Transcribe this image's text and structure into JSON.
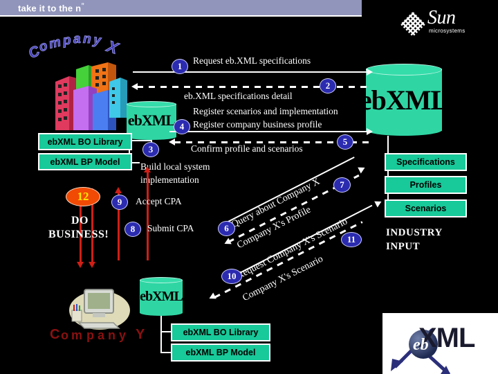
{
  "banner": {
    "text": "take it to the n",
    "superscript": "”"
  },
  "brand": {
    "name": "Sun",
    "tagline": "microsystems",
    "logo_icon": "sun-logo-icon"
  },
  "companies": {
    "left": {
      "name": "Company X",
      "color": "#3b37b5"
    },
    "right": {
      "name": "Company Y",
      "color": "#8a1111"
    }
  },
  "repositories": {
    "left_cylinder": "ebXML",
    "right_cylinder": "ebXML",
    "bottom_cylinder": "ebXML"
  },
  "boxes": {
    "x_bo_library": "ebXML BO Library",
    "x_bp_model": "ebXML BP Model",
    "y_bo_library": "ebXML BO Library",
    "y_bp_model": "ebXML BP Model",
    "registry": [
      "Specifications",
      "Profiles",
      "Scenarios"
    ]
  },
  "flows": [
    {
      "num": "1",
      "label": "Request eb.XML specifications",
      "style": "solid"
    },
    {
      "num": "2",
      "label": "eb.XML specifications detail",
      "style": "dashed"
    },
    {
      "num": "3",
      "label": "Build local system implementation",
      "style": "none"
    },
    {
      "num": "4",
      "label": "Register scenarios and implementation",
      "label2": "Register company business profile",
      "style": "solid"
    },
    {
      "num": "5",
      "label": "Confirm profile and scenarios",
      "style": "dashed"
    },
    {
      "num": "6",
      "label": "Query about Company X",
      "style": "solid"
    },
    {
      "num": "7",
      "label": "Company X's Profile",
      "style": "dashed"
    },
    {
      "num": "8",
      "label": "Submit CPA",
      "style": "solid"
    },
    {
      "num": "9",
      "label": "Accept CPA",
      "style": "solid"
    },
    {
      "num": "10",
      "label": "Request Company X's Scenario",
      "style": "solid"
    },
    {
      "num": "11",
      "label": "Company X's Scenario",
      "style": "dashed"
    },
    {
      "num": "12",
      "label": "DO BUSINESS!",
      "style": "highlight",
      "color": "#f04a05"
    }
  ],
  "labels": {
    "f1": "Request eb.XML specifications",
    "f2": "eb.XML specifications detail",
    "f4a": "Register scenarios and implementation",
    "f4b": "Register company business profile",
    "f5": "Confirm profile and scenarios",
    "f3a": "Build local system",
    "f3b": "implementation",
    "f9": "Accept CPA",
    "f8": "Submit CPA",
    "f6": "Query about Company X",
    "f7": "Company X's Profile",
    "f10": "Request Company X's Scenario",
    "f11": "Company X's Scenario",
    "do_business_1": "DO",
    "do_business_2": "BUSINESS!",
    "industry_1": "INDUSTRY",
    "industry_2": "INPUT"
  },
  "badges": {
    "n1": "1",
    "n2": "2",
    "n3": "3",
    "n4": "4",
    "n5": "5",
    "n6": "6",
    "n7": "7",
    "n8": "8",
    "n9": "9",
    "n10": "10",
    "n11": "11",
    "n12": "12"
  },
  "footer_logo": {
    "text": "XML",
    "mark": "eb",
    "icon": "ebxml-globe-icon"
  },
  "colors": {
    "banner": "#9195bb",
    "green_box": "#18c999",
    "cylinder": "#2fd6a4",
    "badge_blue": "#2b2bb0",
    "badge_orange": "#f04a05",
    "red_arrow": "#cf1f16",
    "background": "#000000"
  }
}
